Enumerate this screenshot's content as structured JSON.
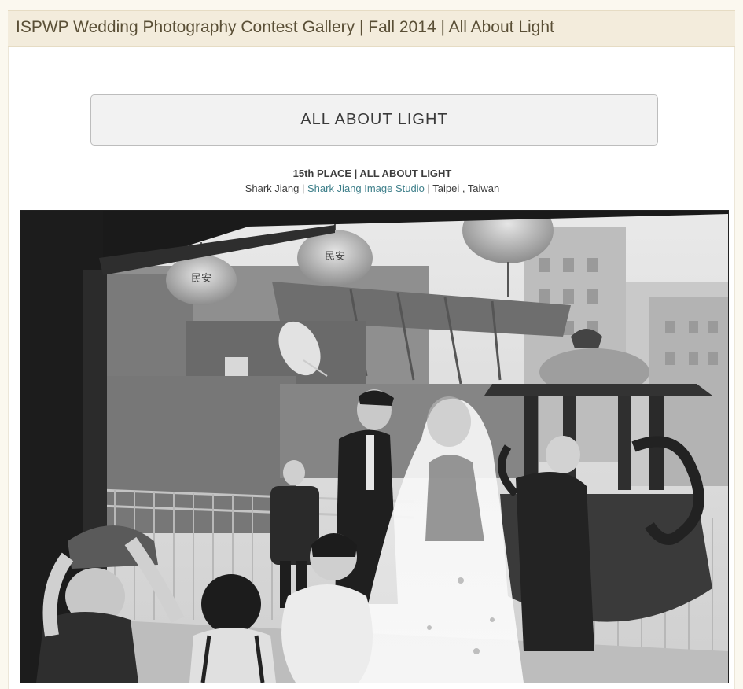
{
  "header": {
    "title": "ISPWP Wedding Photography Contest Gallery | Fall 2014 | All About Light"
  },
  "category_button": {
    "label": "ALL ABOUT LIGHT"
  },
  "entry": {
    "placement": "15th PLACE | ALL ABOUT LIGHT",
    "photographer": "Shark Jiang",
    "separator_1": " | ",
    "studio": "Shark Jiang Image Studio",
    "separator_2": " | ",
    "location": "Taipei , Taiwan"
  },
  "photo": {
    "description_icon": "black-and-white-wedding-photo",
    "lantern_text": "民安"
  },
  "colors": {
    "header_bg": "#f3ecdc",
    "header_text": "#5a4f36",
    "link": "#3e7f8a",
    "button_bg": "#f2f2f2"
  }
}
